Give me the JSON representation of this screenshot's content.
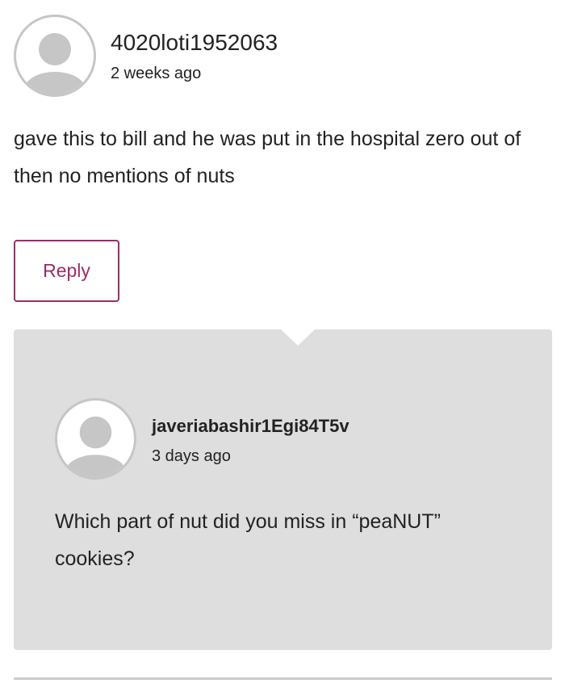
{
  "comment": {
    "username": "4020loti1952063",
    "timestamp": "2 weeks ago",
    "text": "gave this to bill and he was put in the hospital zero out of then no mentions of nuts",
    "avatar_icon": "default-user-avatar-icon",
    "reply_label": "Reply"
  },
  "reply": {
    "username": "javeriabashir1Egi84T5v",
    "timestamp": "3 days ago",
    "text": "Which part of nut did you miss in “peaNUT” cookies?",
    "avatar_icon": "default-user-avatar-icon"
  },
  "colors": {
    "accent": "#9b2c6a",
    "reply_background": "#dedede",
    "avatar_placeholder": "#c6c6c6"
  }
}
